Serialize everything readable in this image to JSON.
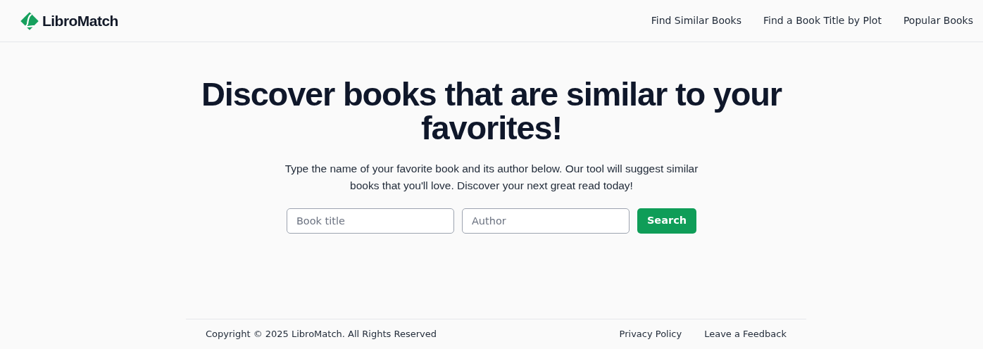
{
  "header": {
    "logo": "LibroMatch",
    "nav": [
      "Find Similar Books",
      "Find a Book Title by Plot",
      "Popular Books"
    ]
  },
  "hero": {
    "title": "Discover books that are similar to your favorites!",
    "subtitle": "Type the name of your favorite book and its author below. Our tool will suggest similar books that you'll love. Discover your next great read today!",
    "fields": [
      {
        "placeholder": "Book title"
      },
      {
        "placeholder": "Author"
      }
    ],
    "button": "Search"
  },
  "footer": {
    "copyright": "Copyright © 2025 LibroMatch. All Rights Reserved",
    "links": [
      "Privacy Policy",
      "Leave a Feedback"
    ]
  }
}
